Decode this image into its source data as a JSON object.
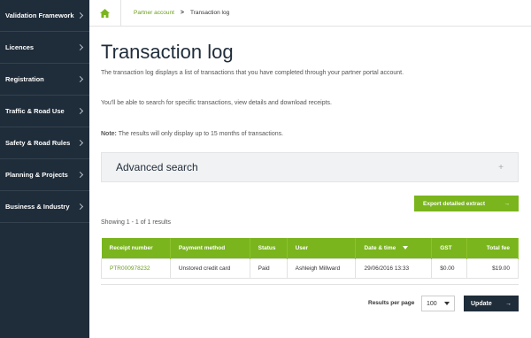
{
  "sidebar": {
    "items": [
      {
        "label": "Validation Framework"
      },
      {
        "label": "Licences"
      },
      {
        "label": "Registration"
      },
      {
        "label": "Traffic & Road Use"
      },
      {
        "label": "Safety & Road Rules"
      },
      {
        "label": "Planning & Projects"
      },
      {
        "label": "Business & Industry"
      }
    ]
  },
  "breadcrumb": {
    "link": "Partner account",
    "separator": ">",
    "current": "Transaction log"
  },
  "page": {
    "title": "Transaction log",
    "intro": "The transaction log displays a list of transactions that you have completed through your partner portal account.",
    "search_info": "You'll be able to search for specific transactions, view details and download receipts.",
    "note_label": "Note:",
    "note_text": " The results will only display up to 15 months of transactions."
  },
  "advanced_search": {
    "title": "Advanced search",
    "plus": "+"
  },
  "export_button": {
    "label": "Export detailed extract",
    "arrow": "→"
  },
  "results": {
    "showing": "Showing 1 - 1 of 1 results"
  },
  "table": {
    "headers": {
      "receipt": "Receipt number",
      "payment": "Payment method",
      "status": "Status",
      "user": "User",
      "datetime": "Date & time",
      "gst": "GST",
      "fee": "Total fee"
    },
    "rows": [
      {
        "receipt": "PTR000978232",
        "payment": "Unstored credit card",
        "status": "Paid",
        "user": "Ashleigh Millward",
        "datetime": "29/06/2016 13:33",
        "gst": "$0.00",
        "fee": "$19.00"
      }
    ]
  },
  "footer": {
    "rpp_label": "Results per page",
    "rpp_value": "100",
    "update_label": "Update",
    "update_arrow": "→"
  },
  "colors": {
    "accent": "#7ab51d",
    "sidebar": "#1f2c3a"
  }
}
